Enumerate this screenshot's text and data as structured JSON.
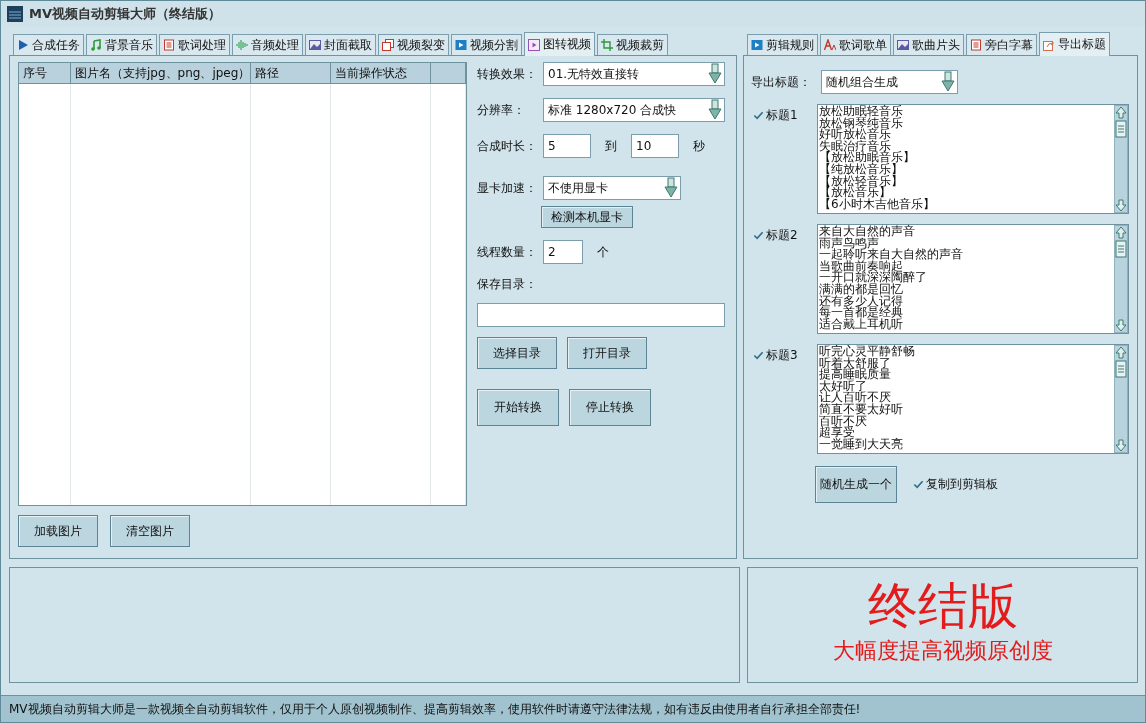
{
  "window": {
    "title": "MV视频自动剪辑大师（终结版）"
  },
  "left_tabs": [
    {
      "label": "合成任务",
      "selected": false
    },
    {
      "label": "背景音乐",
      "selected": false
    },
    {
      "label": "歌词处理",
      "selected": false
    },
    {
      "label": "音频处理",
      "selected": false
    },
    {
      "label": "封面截取",
      "selected": false
    },
    {
      "label": "视频裂变",
      "selected": false
    },
    {
      "label": "视频分割",
      "selected": false
    },
    {
      "label": "图转视频",
      "selected": true
    },
    {
      "label": "视频裁剪",
      "selected": false
    }
  ],
  "table": {
    "columns": [
      "序号",
      "图片名（支持jpg、png、jpeg）",
      "路径",
      "当前操作状态"
    ]
  },
  "table_buttons": [
    "加载图片",
    "清空图片"
  ],
  "form": {
    "effect": {
      "label": "转换效果：",
      "value": "01.无特效直接转"
    },
    "resolution": {
      "label": "分辨率：",
      "value": "标准 1280x720  合成快"
    },
    "duration": {
      "label": "合成时长：",
      "from": "5",
      "between": "到",
      "to": "10",
      "unit": "秒"
    },
    "gpu": {
      "label": "显卡加速：",
      "value": "不使用显卡"
    },
    "detect_button": "检测本机显卡",
    "threads": {
      "label": "线程数量：",
      "value": "2",
      "unit": "个"
    },
    "save_dir": {
      "label": "保存目录："
    },
    "dir_buttons": [
      "选择目录",
      "打开目录"
    ],
    "action_buttons": [
      "开始转换",
      "停止转换"
    ]
  },
  "right_tabs": [
    {
      "label": "剪辑规则",
      "selected": false
    },
    {
      "label": "歌词歌单",
      "selected": false
    },
    {
      "label": "歌曲片头",
      "selected": false
    },
    {
      "label": "旁白字幕",
      "selected": false
    },
    {
      "label": "导出标题",
      "selected": true
    }
  ],
  "export": {
    "label": "导出标题：",
    "value": "随机组合生成"
  },
  "titles": [
    {
      "label": "标题1",
      "checked": true,
      "lines": [
        "放松助眠轻音乐",
        "放松钢琴纯音乐",
        "好听放松音乐",
        "失眠治疗音乐",
        "【放松助眠音乐】",
        "【纯放松音乐】",
        "【放松轻音乐】",
        "【放松音乐】",
        "【6小时木吉他音乐】"
      ]
    },
    {
      "label": "标题2",
      "checked": true,
      "lines": [
        "来自大自然的声音",
        "雨声鸟鸣声",
        "一起聆听来自大自然的声音",
        "当歌曲前奏响起",
        "一开口就深深陶醉了",
        "满满的都是回忆",
        "还有多少人记得",
        "每一首都是经典",
        "适合戴上耳机听"
      ]
    },
    {
      "label": "标题3",
      "checked": true,
      "lines": [
        "听完心灵平静舒畅",
        "听着太舒服了",
        "提高睡眠质量",
        "太好听了",
        "让人百听不厌",
        "简直不要太好听",
        "百听不厌",
        "超享受",
        "一觉睡到大天亮"
      ]
    }
  ],
  "generate_button": "随机生成一个",
  "copy_option": {
    "label": "复制到剪辑板",
    "checked": true
  },
  "banner": {
    "headline": "终结版",
    "subline": "大幅度提高视频原创度"
  },
  "status_bar": "MV视频自动剪辑大师是一款视频全自动剪辑软件，仅用于个人原创视频制作、提高剪辑效率，使用软件时请遵守法律法规，如有违反由使用者自行承担全部责任!"
}
